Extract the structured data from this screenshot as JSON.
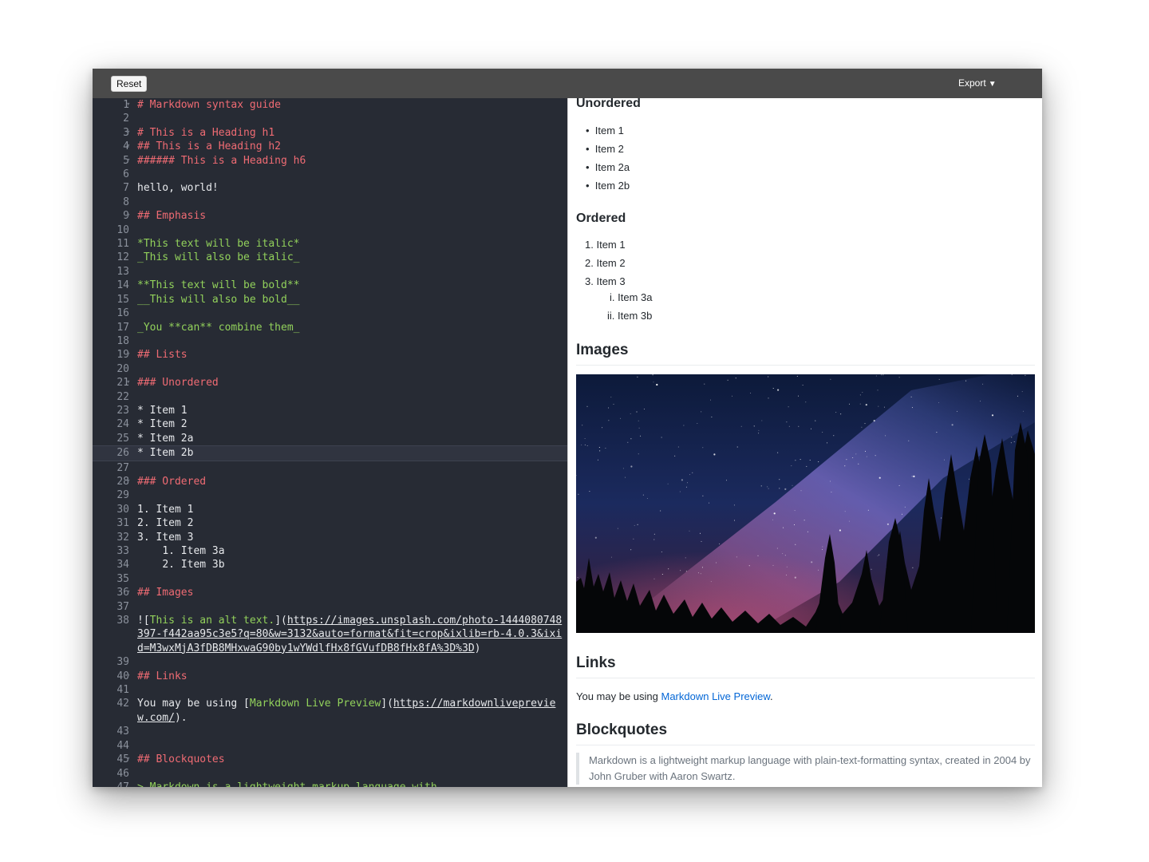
{
  "toolbar": {
    "reset_label": "Reset",
    "export_label": "Export",
    "export_caret": "▼"
  },
  "editor": {
    "active_line": 26,
    "lines": [
      {
        "n": "1",
        "fold": true,
        "parts": [
          {
            "t": "# Markdown syntax guide",
            "c": "h"
          }
        ]
      },
      {
        "n": "2",
        "parts": []
      },
      {
        "n": "3",
        "fold": true,
        "parts": [
          {
            "t": "# This is a Heading h1",
            "c": "h"
          }
        ]
      },
      {
        "n": "4",
        "fold": true,
        "parts": [
          {
            "t": "## This is a Heading h2",
            "c": "h"
          }
        ]
      },
      {
        "n": "5",
        "fold": true,
        "parts": [
          {
            "t": "###### This is a Heading h6",
            "c": "h"
          }
        ]
      },
      {
        "n": "6",
        "parts": []
      },
      {
        "n": "7",
        "parts": [
          {
            "t": "hello, world!",
            "c": "plain"
          }
        ]
      },
      {
        "n": "8",
        "parts": []
      },
      {
        "n": "9",
        "fold": true,
        "parts": [
          {
            "t": "## Emphasis",
            "c": "h"
          }
        ]
      },
      {
        "n": "10",
        "parts": []
      },
      {
        "n": "11",
        "parts": [
          {
            "t": "*This text will be italic*",
            "c": "em"
          }
        ]
      },
      {
        "n": "12",
        "parts": [
          {
            "t": "_This will also be italic_",
            "c": "em"
          }
        ]
      },
      {
        "n": "13",
        "parts": []
      },
      {
        "n": "14",
        "parts": [
          {
            "t": "**This text will be bold**",
            "c": "em"
          }
        ]
      },
      {
        "n": "15",
        "parts": [
          {
            "t": "__This will also be bold__",
            "c": "em"
          }
        ]
      },
      {
        "n": "16",
        "parts": []
      },
      {
        "n": "17",
        "parts": [
          {
            "t": "_You **can** combine them_",
            "c": "em"
          }
        ]
      },
      {
        "n": "18",
        "parts": []
      },
      {
        "n": "19",
        "fold": true,
        "parts": [
          {
            "t": "## Lists",
            "c": "h"
          }
        ]
      },
      {
        "n": "20",
        "parts": []
      },
      {
        "n": "21",
        "fold": true,
        "parts": [
          {
            "t": "### Unordered",
            "c": "h"
          }
        ]
      },
      {
        "n": "22",
        "parts": []
      },
      {
        "n": "23",
        "parts": [
          {
            "t": "* Item 1",
            "c": "plain"
          }
        ]
      },
      {
        "n": "24",
        "parts": [
          {
            "t": "* Item 2",
            "c": "plain"
          }
        ]
      },
      {
        "n": "25",
        "parts": [
          {
            "t": "* Item 2a",
            "c": "plain"
          }
        ]
      },
      {
        "n": "26",
        "parts": [
          {
            "t": "* Item 2b",
            "c": "plain"
          }
        ]
      },
      {
        "n": "27",
        "parts": []
      },
      {
        "n": "28",
        "fold": true,
        "parts": [
          {
            "t": "### Ordered",
            "c": "h"
          }
        ]
      },
      {
        "n": "29",
        "parts": []
      },
      {
        "n": "30",
        "parts": [
          {
            "t": "1. Item 1",
            "c": "plain"
          }
        ]
      },
      {
        "n": "31",
        "parts": [
          {
            "t": "2. Item 2",
            "c": "plain"
          }
        ]
      },
      {
        "n": "32",
        "parts": [
          {
            "t": "3. Item 3",
            "c": "plain"
          }
        ]
      },
      {
        "n": "33",
        "parts": [
          {
            "t": "    1. Item 3a",
            "c": "plain"
          }
        ]
      },
      {
        "n": "34",
        "parts": [
          {
            "t": "    2. Item 3b",
            "c": "plain"
          }
        ]
      },
      {
        "n": "35",
        "parts": []
      },
      {
        "n": "36",
        "fold": true,
        "parts": [
          {
            "t": "## Images",
            "c": "h"
          }
        ]
      },
      {
        "n": "37",
        "parts": []
      },
      {
        "n": "38",
        "parts": [
          {
            "t": "![",
            "c": "plain"
          },
          {
            "t": "This is an alt text.",
            "c": "link"
          },
          {
            "t": "](",
            "c": "plain"
          },
          {
            "t": "https://images.unsplash.com/photo-1444080748397-f442aa95c3e5?q=80&w=3132&auto=format&fit=crop&ixlib=rb-4.0.3&ixid=M3wxMjA3fDB8MHxwaG90by1wYWdlfHx8fGVufDB8fHx8fA%3D%3D",
            "c": "url"
          },
          {
            "t": ")",
            "c": "plain"
          }
        ]
      },
      {
        "n": "39",
        "parts": []
      },
      {
        "n": "40",
        "fold": true,
        "parts": [
          {
            "t": "## Links",
            "c": "h"
          }
        ]
      },
      {
        "n": "41",
        "parts": []
      },
      {
        "n": "42",
        "parts": [
          {
            "t": "You may be using [",
            "c": "plain"
          },
          {
            "t": "Markdown Live Preview",
            "c": "link"
          },
          {
            "t": "](",
            "c": "plain"
          },
          {
            "t": "https://markdownlivepreview.com/",
            "c": "url"
          },
          {
            "t": ").",
            "c": "plain"
          }
        ]
      },
      {
        "n": "43",
        "parts": []
      },
      {
        "n": "44",
        "parts": []
      },
      {
        "n": "45",
        "fold": true,
        "parts": [
          {
            "t": "## Blockquotes",
            "c": "h"
          }
        ]
      },
      {
        "n": "46",
        "parts": []
      },
      {
        "n": "47",
        "parts": [
          {
            "t": "> Markdown is a lightweight markup language with",
            "c": "em"
          }
        ]
      }
    ]
  },
  "preview": {
    "unordered_heading": "Unordered",
    "unordered_items": [
      "Item 1",
      "Item 2",
      "Item 2a",
      "Item 2b"
    ],
    "ordered_heading": "Ordered",
    "ordered_items": [
      {
        "marker": "1.",
        "label": "Item 1"
      },
      {
        "marker": "2.",
        "label": "Item 2"
      },
      {
        "marker": "3.",
        "label": "Item 3"
      }
    ],
    "ordered_subitems": [
      {
        "marker": "i.",
        "label": "Item 3a"
      },
      {
        "marker": "ii.",
        "label": "Item 3b"
      }
    ],
    "images_heading": "Images",
    "links_heading": "Links",
    "links_text_before": "You may be using ",
    "links_link_text": "Markdown Live Preview",
    "links_text_after": ".",
    "blockquotes_heading": "Blockquotes",
    "blockquote_text": "Markdown is a lightweight markup language with plain-text-formatting syntax, created in 2004 by John Gruber with Aaron Swartz."
  },
  "colors": {
    "editor_bg": "#272b34",
    "toolbar_bg": "#4a4a4a",
    "heading_syntax": "#ef6b73",
    "emphasis_syntax": "#92d15b",
    "preview_link": "#0366d6"
  }
}
